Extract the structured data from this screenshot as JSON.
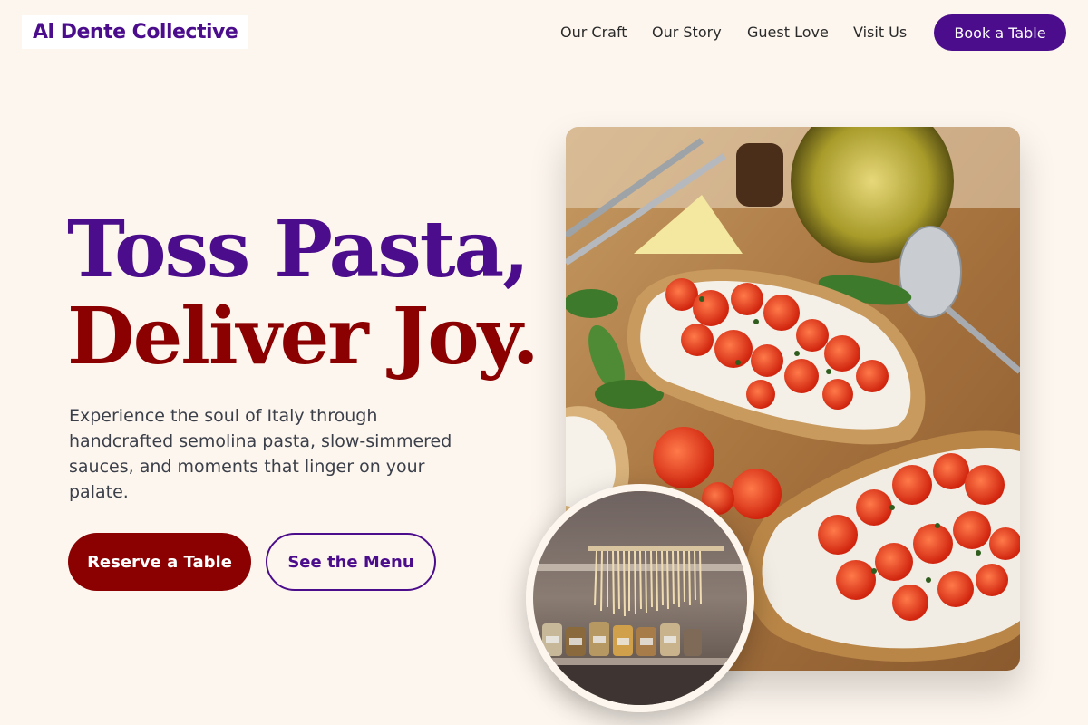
{
  "header": {
    "logo": "Al Dente Collective",
    "nav": [
      {
        "label": "Our Craft"
      },
      {
        "label": "Our Story"
      },
      {
        "label": "Guest Love"
      },
      {
        "label": "Visit Us"
      }
    ],
    "cta_label": "Book a Table"
  },
  "hero": {
    "title_line1": "Toss Pasta,",
    "title_line2": "Deliver Joy.",
    "description": "Experience the soul of Italy through handcrafted semolina pasta, slow-simmered sauces, and moments that linger on your palate.",
    "primary_cta": "Reserve a Table",
    "secondary_cta": "See the Menu"
  },
  "colors": {
    "background": "#fdf6ee",
    "brand_purple": "#4b0d8c",
    "brand_red": "#8b0000"
  }
}
